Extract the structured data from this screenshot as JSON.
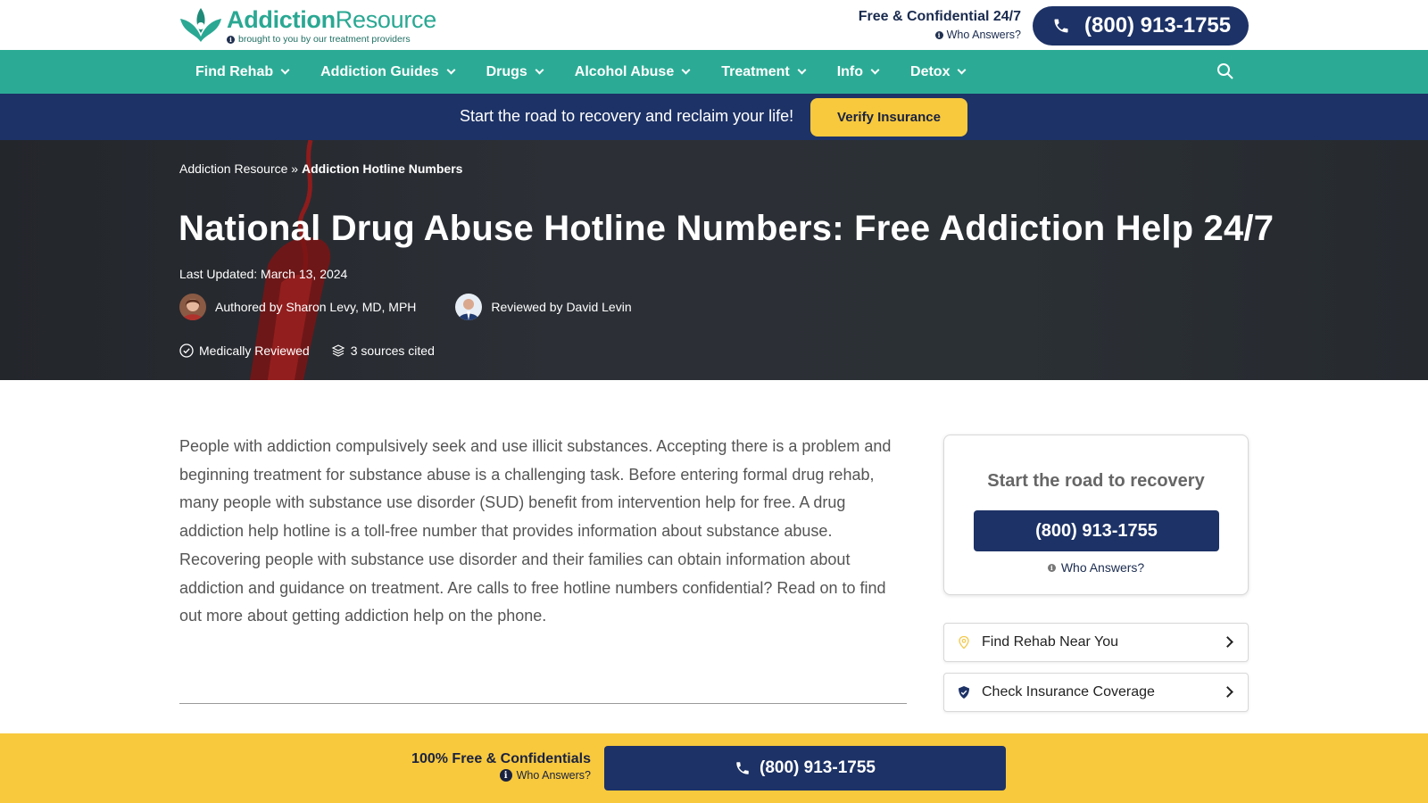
{
  "header": {
    "logo_name_part1": "Addiction",
    "logo_name_part2": "Resource",
    "logo_tagline": "brought to you by our treatment providers",
    "free_confidential": "Free & Confidential 24/7",
    "who_answers": "Who Answers?",
    "phone": "(800) 913-1755"
  },
  "nav": {
    "items": [
      {
        "label": "Find Rehab"
      },
      {
        "label": "Addiction Guides"
      },
      {
        "label": "Drugs"
      },
      {
        "label": "Alcohol Abuse"
      },
      {
        "label": "Treatment"
      },
      {
        "label": "Info"
      },
      {
        "label": "Detox"
      }
    ]
  },
  "banner": {
    "text": "Start the road to recovery and reclaim your life!",
    "button": "Verify Insurance"
  },
  "hero": {
    "breadcrumb_root": "Addiction Resource",
    "breadcrumb_sep": " » ",
    "breadcrumb_current": "Addiction Hotline Numbers",
    "title": "National Drug Abuse Hotline Numbers: Free Addiction Help 24/7",
    "last_updated": "Last Updated: March 13, 2024",
    "author": "Authored by Sharon Levy, MD, MPH",
    "reviewer": "Reviewed by David Levin",
    "medically_reviewed": "Medically Reviewed",
    "sources": "3 sources cited"
  },
  "article": {
    "intro": "People with addiction compulsively seek and use illicit substances. Accepting there is a problem and beginning treatment for substance abuse is a challenging task. Before entering formal drug rehab, many people with substance use disorder (SUD) benefit from intervention help for free. A drug addiction help hotline is a toll-free number that provides information about substance abuse. Recovering people with substance use disorder and their families can obtain information about addiction and guidance on treatment. Are calls to free hotline numbers confidential? Read on to find out more about getting addiction help on the phone."
  },
  "sidebar": {
    "card_title": "Start the road to recovery",
    "card_phone": "(800) 913-1755",
    "card_who": "Who Answers?",
    "link1": "Find Rehab Near You",
    "link2": "Check Insurance Coverage"
  },
  "sticky": {
    "free": "100% Free & Confidentials",
    "who": "Who Answers?",
    "phone": "(800) 913-1755"
  },
  "colors": {
    "teal": "#2bab95",
    "navy": "#1d3266",
    "yellow": "#f8c93d"
  }
}
